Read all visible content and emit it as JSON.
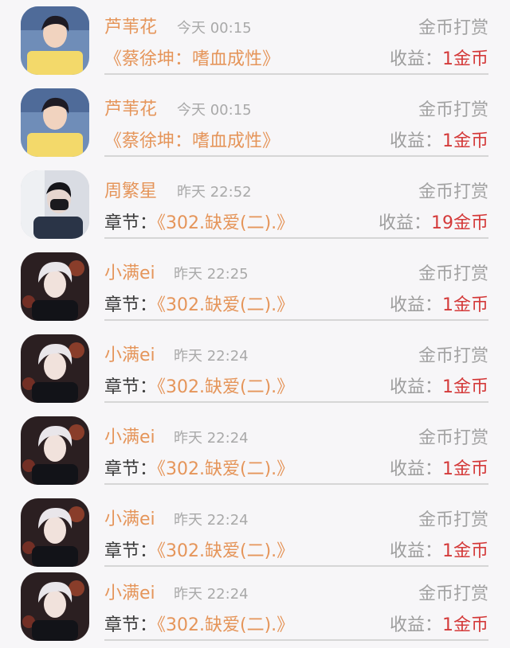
{
  "records": [
    {
      "name": "芦苇花",
      "time": "今天 00:15",
      "type": "金币打赏",
      "prefix": "",
      "title": "《蔡徐坤：嗜血成性》",
      "earn_label": "收益：",
      "earn_value": "1金币",
      "avatar": "avatar-yellow"
    },
    {
      "name": "芦苇花",
      "time": "今天 00:15",
      "type": "金币打赏",
      "prefix": "",
      "title": "《蔡徐坤：嗜血成性》",
      "earn_label": "收益：",
      "earn_value": "1金币",
      "avatar": "avatar-yellow"
    },
    {
      "name": "周繁星",
      "time": "昨天 22:52",
      "type": "金币打赏",
      "prefix": "章节：",
      "title": "《302.缺爱(二).》",
      "earn_label": "收益：",
      "earn_value": "19金币",
      "avatar": "avatar-mask"
    },
    {
      "name": "小满ei",
      "time": "昨天 22:25",
      "type": "金币打赏",
      "prefix": "章节：",
      "title": "《302.缺爱(二).》",
      "earn_label": "收益：",
      "earn_value": "1金币",
      "avatar": "avatar-white-hair"
    },
    {
      "name": "小满ei",
      "time": "昨天 22:24",
      "type": "金币打赏",
      "prefix": "章节：",
      "title": "《302.缺爱(二).》",
      "earn_label": "收益：",
      "earn_value": "1金币",
      "avatar": "avatar-white-hair"
    },
    {
      "name": "小满ei",
      "time": "昨天 22:24",
      "type": "金币打赏",
      "prefix": "章节：",
      "title": "《302.缺爱(二).》",
      "earn_label": "收益：",
      "earn_value": "1金币",
      "avatar": "avatar-white-hair"
    },
    {
      "name": "小满ei",
      "time": "昨天 22:24",
      "type": "金币打赏",
      "prefix": "章节：",
      "title": "《302.缺爱(二).》",
      "earn_label": "收益：",
      "earn_value": "1金币",
      "avatar": "avatar-white-hair"
    },
    {
      "name": "小满ei",
      "time": "昨天 22:24",
      "type": "金币打赏",
      "prefix": "章节：",
      "title": "《302.缺爱(二).》",
      "earn_label": "收益：",
      "earn_value": "1金币",
      "avatar": "avatar-white-hair"
    }
  ],
  "colors": {
    "name": "#e5955a",
    "title": "#e5955a",
    "earn_value": "#d43a3a",
    "muted": "#a3a3a3",
    "divider": "#d6d6d6",
    "background": "#f7f6f8"
  }
}
